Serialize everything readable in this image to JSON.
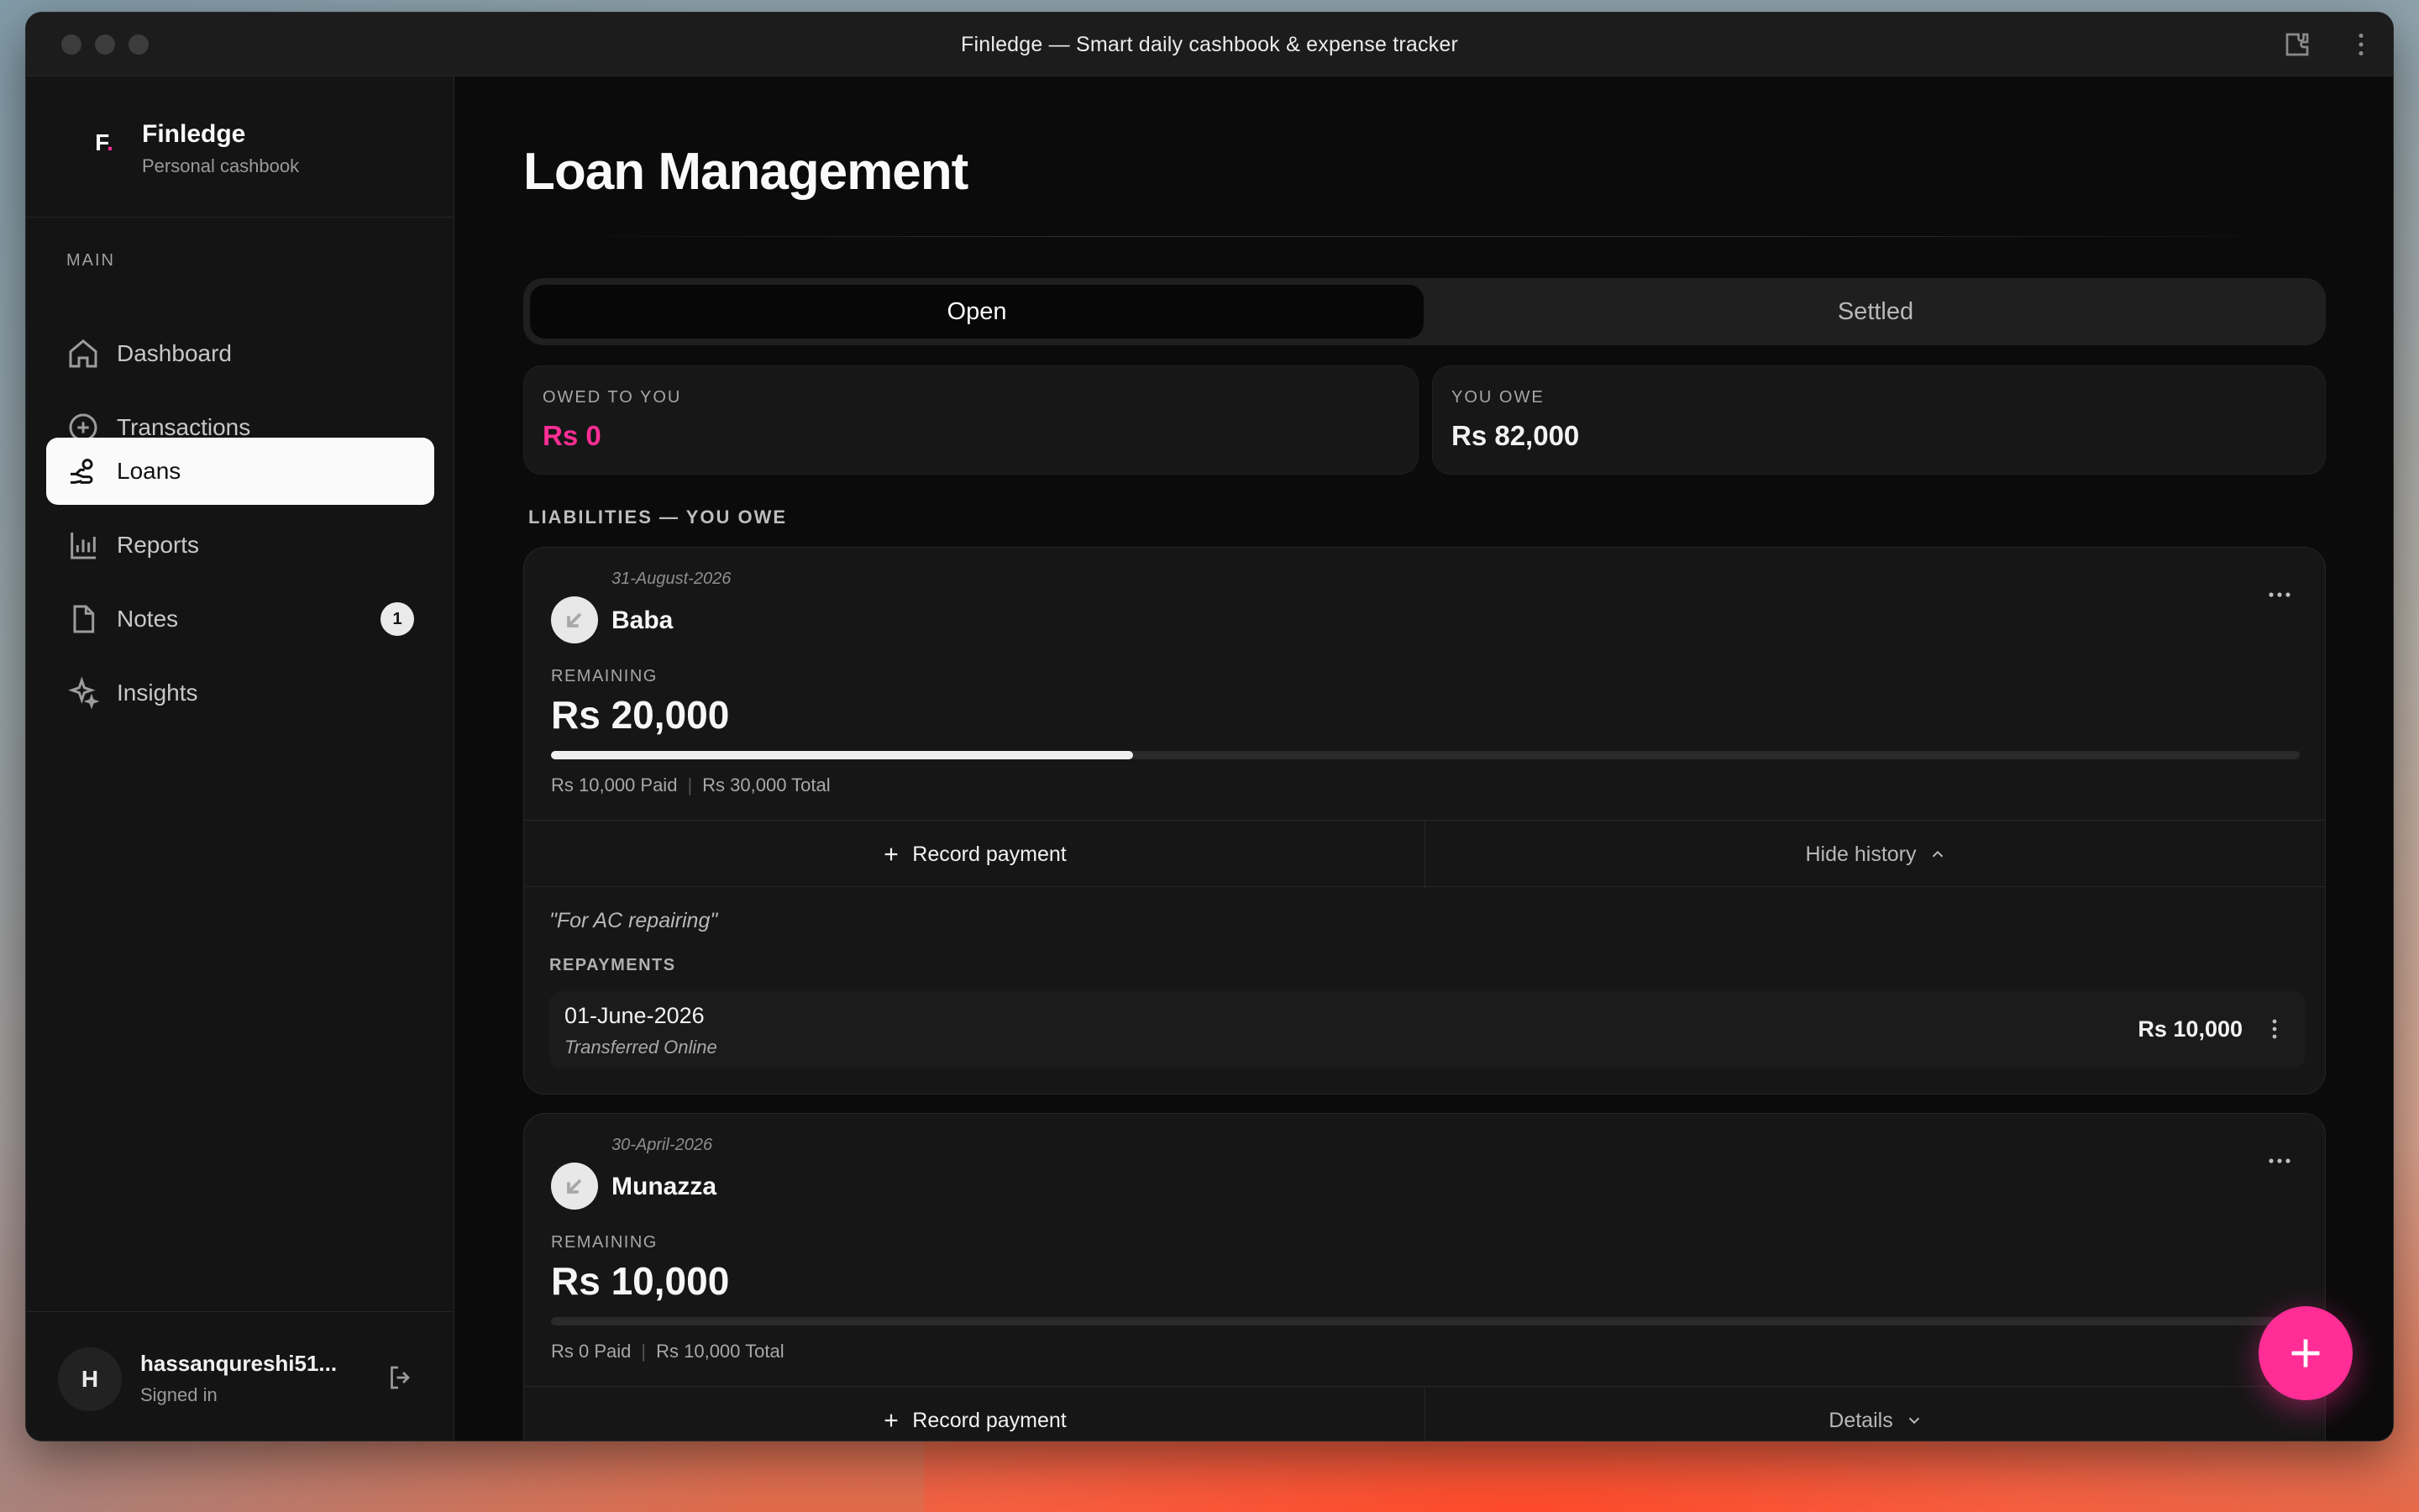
{
  "window": {
    "title": "Finledge — Smart daily cashbook & expense tracker"
  },
  "brand": {
    "logo": "F",
    "name": "Finledge",
    "subtitle": "Personal cashbook"
  },
  "sidebar": {
    "section": "MAIN",
    "items": [
      {
        "label": "Dashboard",
        "icon": "home-icon",
        "active": false
      },
      {
        "label": "Transactions",
        "icon": "plus-circle-icon",
        "active": false
      },
      {
        "label": "Loans",
        "icon": "hand-coins-icon",
        "active": true
      },
      {
        "label": "Reports",
        "icon": "bar-chart-icon",
        "active": false
      },
      {
        "label": "Notes",
        "icon": "file-icon",
        "active": false,
        "badge": "1"
      },
      {
        "label": "Insights",
        "icon": "sparkles-icon",
        "active": false
      }
    ]
  },
  "user": {
    "initial": "H",
    "name": "hassanqureshi51...",
    "status": "Signed in"
  },
  "page": {
    "title": "Loan Management"
  },
  "tabs": [
    {
      "label": "Open",
      "selected": true
    },
    {
      "label": "Settled",
      "selected": false
    }
  ],
  "stats": {
    "owed_to_you": {
      "label": "OWED TO YOU",
      "value": "Rs 0",
      "color": "#ff2d95"
    },
    "you_owe": {
      "label": "YOU OWE",
      "value": "Rs 82,000",
      "color": "#f2f2f2"
    }
  },
  "list_label": "LIABILITIES — YOU OWE",
  "loans": [
    {
      "date": "31-August-2026",
      "name": "Baba",
      "remaining_label": "REMAINING",
      "remaining": "Rs 20,000",
      "progress": 0.333,
      "paid": "Rs 10,000 Paid",
      "total": "Rs 30,000 Total",
      "primary_action": "Record payment",
      "secondary_action": "Hide history",
      "note": "\"For AC repairing\"",
      "repayments_label": "REPAYMENTS",
      "repayments": [
        {
          "date": "01-June-2026",
          "method": "Transferred Online",
          "amount": "Rs 10,000"
        }
      ]
    },
    {
      "date": "30-April-2026",
      "name": "Munazza",
      "remaining_label": "REMAINING",
      "remaining": "Rs 10,000",
      "progress": 0,
      "paid": "Rs 0 Paid",
      "total": "Rs 10,000 Total",
      "primary_action": "Record payment",
      "secondary_action": "Details"
    }
  ],
  "colors": {
    "accent": "#ff2d95",
    "background": "#0b0b0b",
    "card": "#161616"
  }
}
